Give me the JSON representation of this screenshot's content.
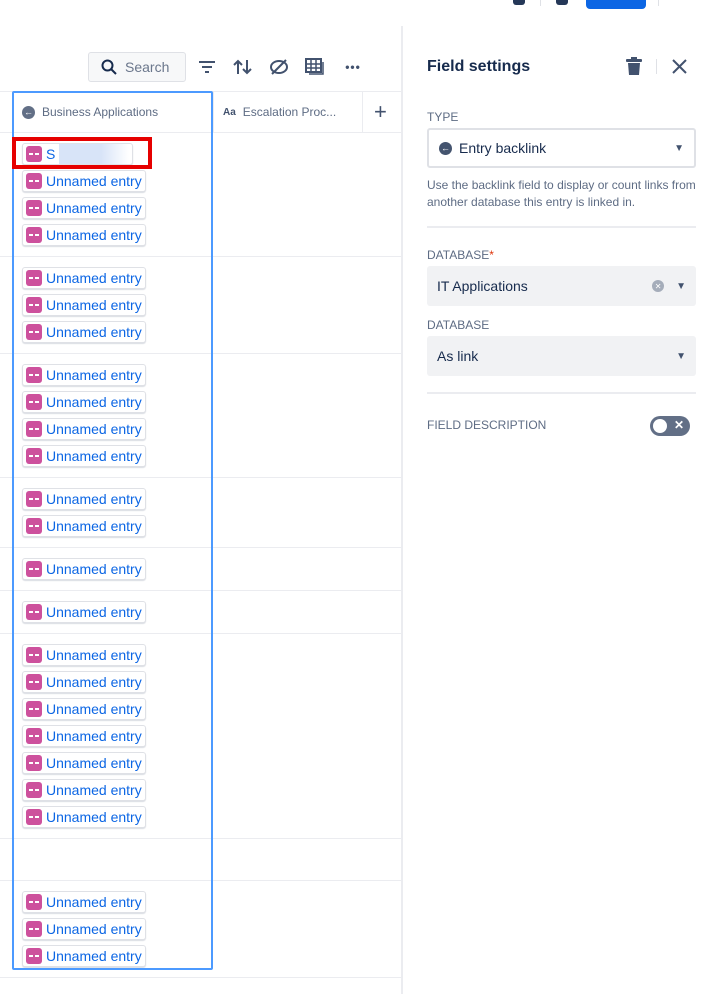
{
  "toolbar": {
    "search_placeholder": "Search",
    "more_label": "•••",
    "add_column": "+"
  },
  "columns": [
    {
      "label": "Business Applications",
      "icon": "backlink-icon"
    },
    {
      "label": "Escalation Proc...",
      "icon_text": "Aa"
    }
  ],
  "rows": [
    [
      "S",
      "Unnamed entry",
      "Unnamed entry",
      "Unnamed entry"
    ],
    [
      "Unnamed entry",
      "Unnamed entry",
      "Unnamed entry"
    ],
    [
      "Unnamed entry",
      "Unnamed entry",
      "Unnamed entry",
      "Unnamed entry"
    ],
    [
      "Unnamed entry",
      "Unnamed entry"
    ],
    [
      "Unnamed entry"
    ],
    [
      "Unnamed entry"
    ],
    [
      "Unnamed entry",
      "Unnamed entry",
      "Unnamed entry",
      "Unnamed entry",
      "Unnamed entry",
      "Unnamed entry",
      "Unnamed entry"
    ],
    [],
    [
      "Unnamed entry",
      "Unnamed entry",
      "Unnamed entry"
    ]
  ],
  "panel": {
    "title": "Field settings",
    "type_label": "Type",
    "type_value": "Entry backlink",
    "help": "Use the backlink field to display or count links from another database this entry is linked in.",
    "database_label": "Database",
    "required_mark": "*",
    "database_value": "IT Applications",
    "display_label": "Database",
    "display_value": "As link",
    "description_label": "Field description",
    "description_enabled": false
  },
  "colors": {
    "accent": "#0c66e4",
    "chip_icon": "#cd519d",
    "highlight": "#e60000"
  }
}
